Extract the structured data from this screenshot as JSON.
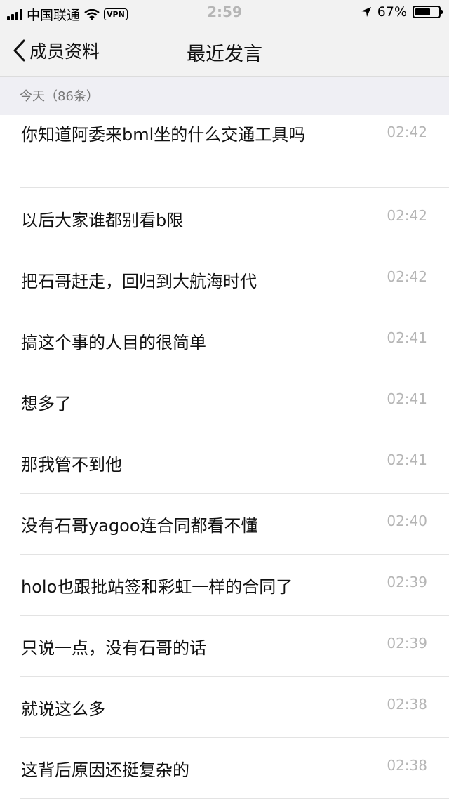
{
  "status_bar": {
    "carrier": "中国联通",
    "vpn": "VPN",
    "time": "2:59",
    "battery": "67%",
    "battery_level": 0.67
  },
  "nav": {
    "back_label": "成员资料",
    "title": "最近发言"
  },
  "section": {
    "header": "今天（86条）"
  },
  "messages": [
    {
      "text": "你知道阿委来bml坐的什么交通工具吗",
      "time": "02:42"
    },
    {
      "text": "以后大家谁都别看b限",
      "time": "02:42"
    },
    {
      "text": "把石哥赶走，回归到大航海时代",
      "time": "02:42"
    },
    {
      "text": "搞这个事的人目的很简单",
      "time": "02:41"
    },
    {
      "text": "想多了",
      "time": "02:41"
    },
    {
      "text": "那我管不到他",
      "time": "02:41"
    },
    {
      "text": "没有石哥yagoo连合同都看不懂",
      "time": "02:40"
    },
    {
      "text": "holo也跟批站签和彩虹一样的合同了",
      "time": "02:39"
    },
    {
      "text": "只说一点，没有石哥的话",
      "time": "02:39"
    },
    {
      "text": "就说这么多",
      "time": "02:38"
    },
    {
      "text": "这背后原因还挺复杂的",
      "time": "02:38"
    }
  ]
}
